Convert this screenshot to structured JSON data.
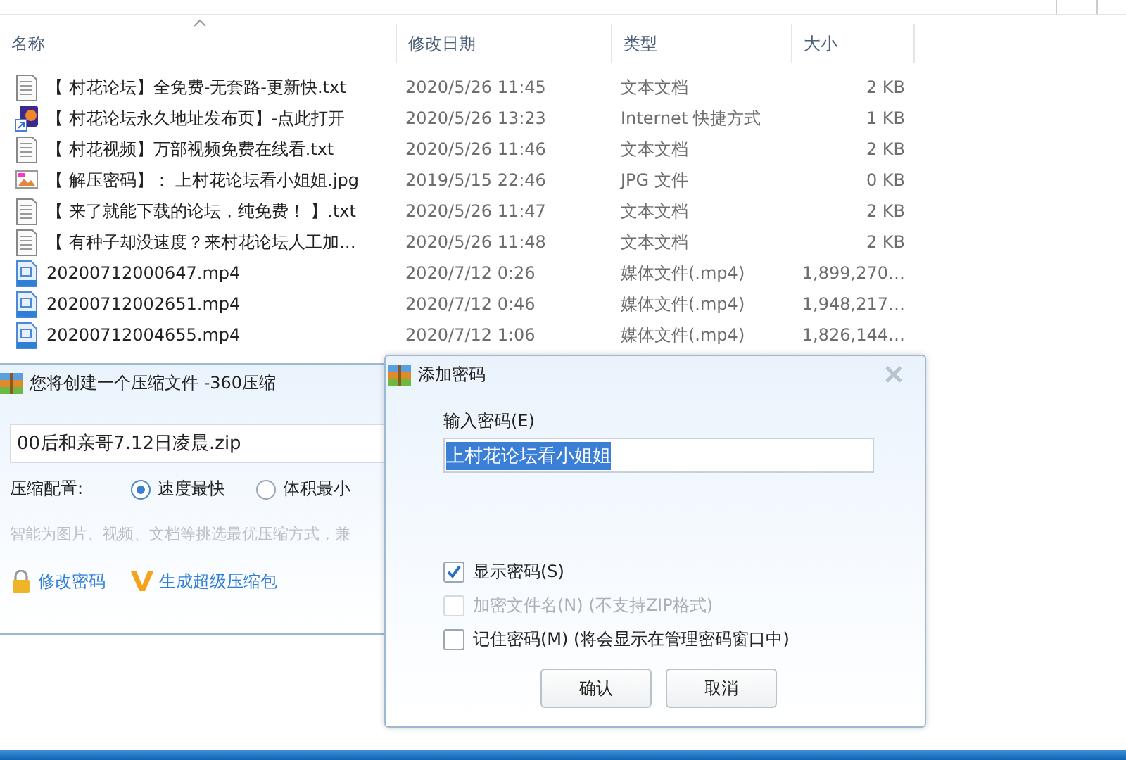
{
  "explorer": {
    "columns": [
      "名称",
      "修改日期",
      "类型",
      "大小"
    ],
    "rows": [
      {
        "kind": "text",
        "name": "【 村花论坛】全免费-无套路-更新快.txt",
        "date": "2020/5/26 11:45",
        "type": "文本文档",
        "size": "2 KB"
      },
      {
        "kind": "shortcut",
        "name": "【 村花论坛永久地址发布页】-点此打开",
        "date": "2020/5/26 13:23",
        "type": "Internet 快捷方式",
        "size": "1 KB"
      },
      {
        "kind": "text",
        "name": "【 村花视频】万部视频免费在线看.txt",
        "date": "2020/5/26 11:46",
        "type": "文本文档",
        "size": "2 KB"
      },
      {
        "kind": "image",
        "name": "【 解压密码】： 上村花论坛看小姐姐.jpg",
        "date": "2019/5/15 22:46",
        "type": "JPG 文件",
        "size": "0 KB"
      },
      {
        "kind": "text",
        "name": "【 来了就能下载的论坛，纯免费！ 】.txt",
        "date": "2020/5/26 11:47",
        "type": "文本文档",
        "size": "2 KB"
      },
      {
        "kind": "text",
        "name": "【 有种子却没速度？来村花论坛人工加…",
        "date": "2020/5/26 11:48",
        "type": "文本文档",
        "size": "2 KB"
      },
      {
        "kind": "video",
        "name": "20200712000647.mp4",
        "date": "2020/7/12 0:26",
        "type": "媒体文件(.mp4)",
        "size": "1,899,270…"
      },
      {
        "kind": "video",
        "name": "20200712002651.mp4",
        "date": "2020/7/12 0:46",
        "type": "媒体文件(.mp4)",
        "size": "1,948,217…"
      },
      {
        "kind": "video",
        "name": "20200712004655.mp4",
        "date": "2020/7/12 1:06",
        "type": "媒体文件(.mp4)",
        "size": "1,826,144…"
      }
    ]
  },
  "compress_dialog": {
    "title": "您将创建一个压缩文件 -360压缩",
    "filename": "00后和亲哥7.12日凌晨.zip",
    "config_label": "压缩配置:",
    "options": [
      {
        "label": "速度最快",
        "selected": true
      },
      {
        "label": "体积最小",
        "selected": false
      }
    ],
    "hint": "智能为图片、视频、文档等挑选最优压缩方式，兼",
    "links": [
      {
        "kind": "lock",
        "label": "修改密码"
      },
      {
        "kind": "vip",
        "label": "生成超级压缩包"
      }
    ]
  },
  "password_dialog": {
    "title": "添加密码",
    "field_label": "输入密码(E)",
    "value": "上村花论坛看小姐姐",
    "value_selected": true,
    "checkboxes": [
      {
        "label": "显示密码(S)",
        "checked": true,
        "disabled": false
      },
      {
        "label": "加密文件名(N) (不支持ZIP格式)",
        "checked": false,
        "disabled": true
      },
      {
        "label": "记住密码(M) (将会显示在管理密码窗口中)",
        "checked": false,
        "disabled": false
      }
    ],
    "buttons": [
      "确认",
      "取消"
    ]
  }
}
